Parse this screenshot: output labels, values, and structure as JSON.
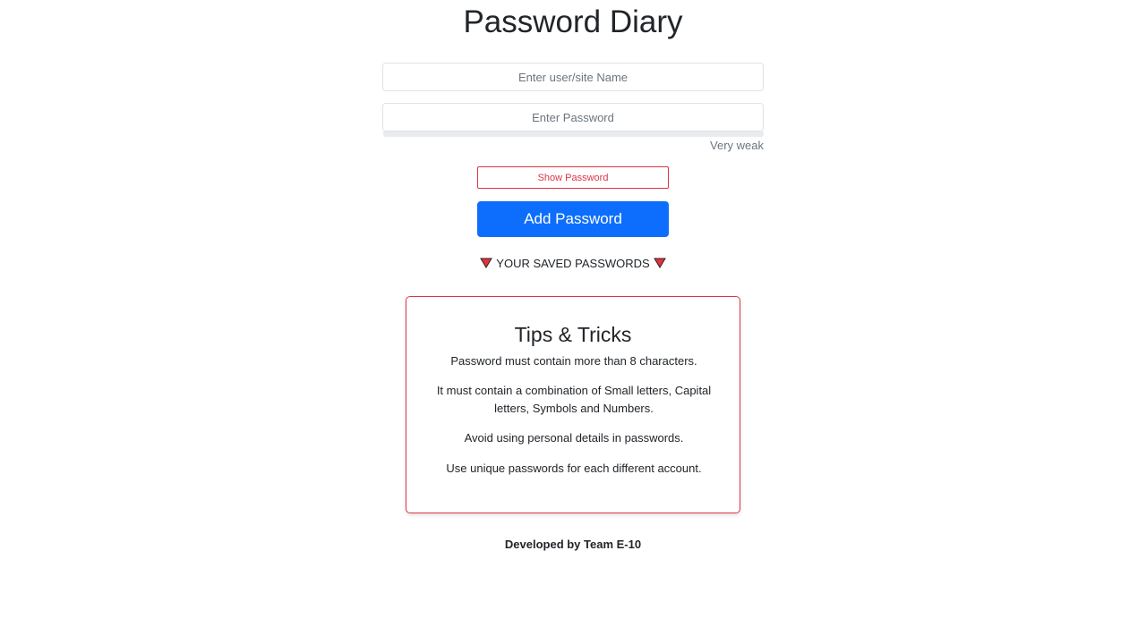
{
  "header": {
    "title": "Password Diary"
  },
  "form": {
    "username_placeholder": "Enter user/site Name",
    "username_value": "",
    "password_placeholder": "Enter Password",
    "password_value": "",
    "strength_label": "Very weak",
    "strength_level": 0,
    "show_password_label": "Show Password",
    "add_password_label": "Add Password"
  },
  "saved": {
    "heading": "YOUR SAVED PASSWORDS",
    "icon": "red-triangle-down-icon"
  },
  "tips": {
    "title": "Tips & Tricks",
    "items": [
      "Password must contain more than 8 characters.",
      "It must contain a combination of Small letters, Capital letters, Symbols and Numbers.",
      "Avoid using personal details in passwords.",
      "Use unique passwords for each different account."
    ]
  },
  "footer": {
    "text": "Developed by Team E-10"
  },
  "colors": {
    "primary": "#0d6efd",
    "danger": "#dc3545",
    "text": "#212529",
    "muted": "#6c757d"
  }
}
